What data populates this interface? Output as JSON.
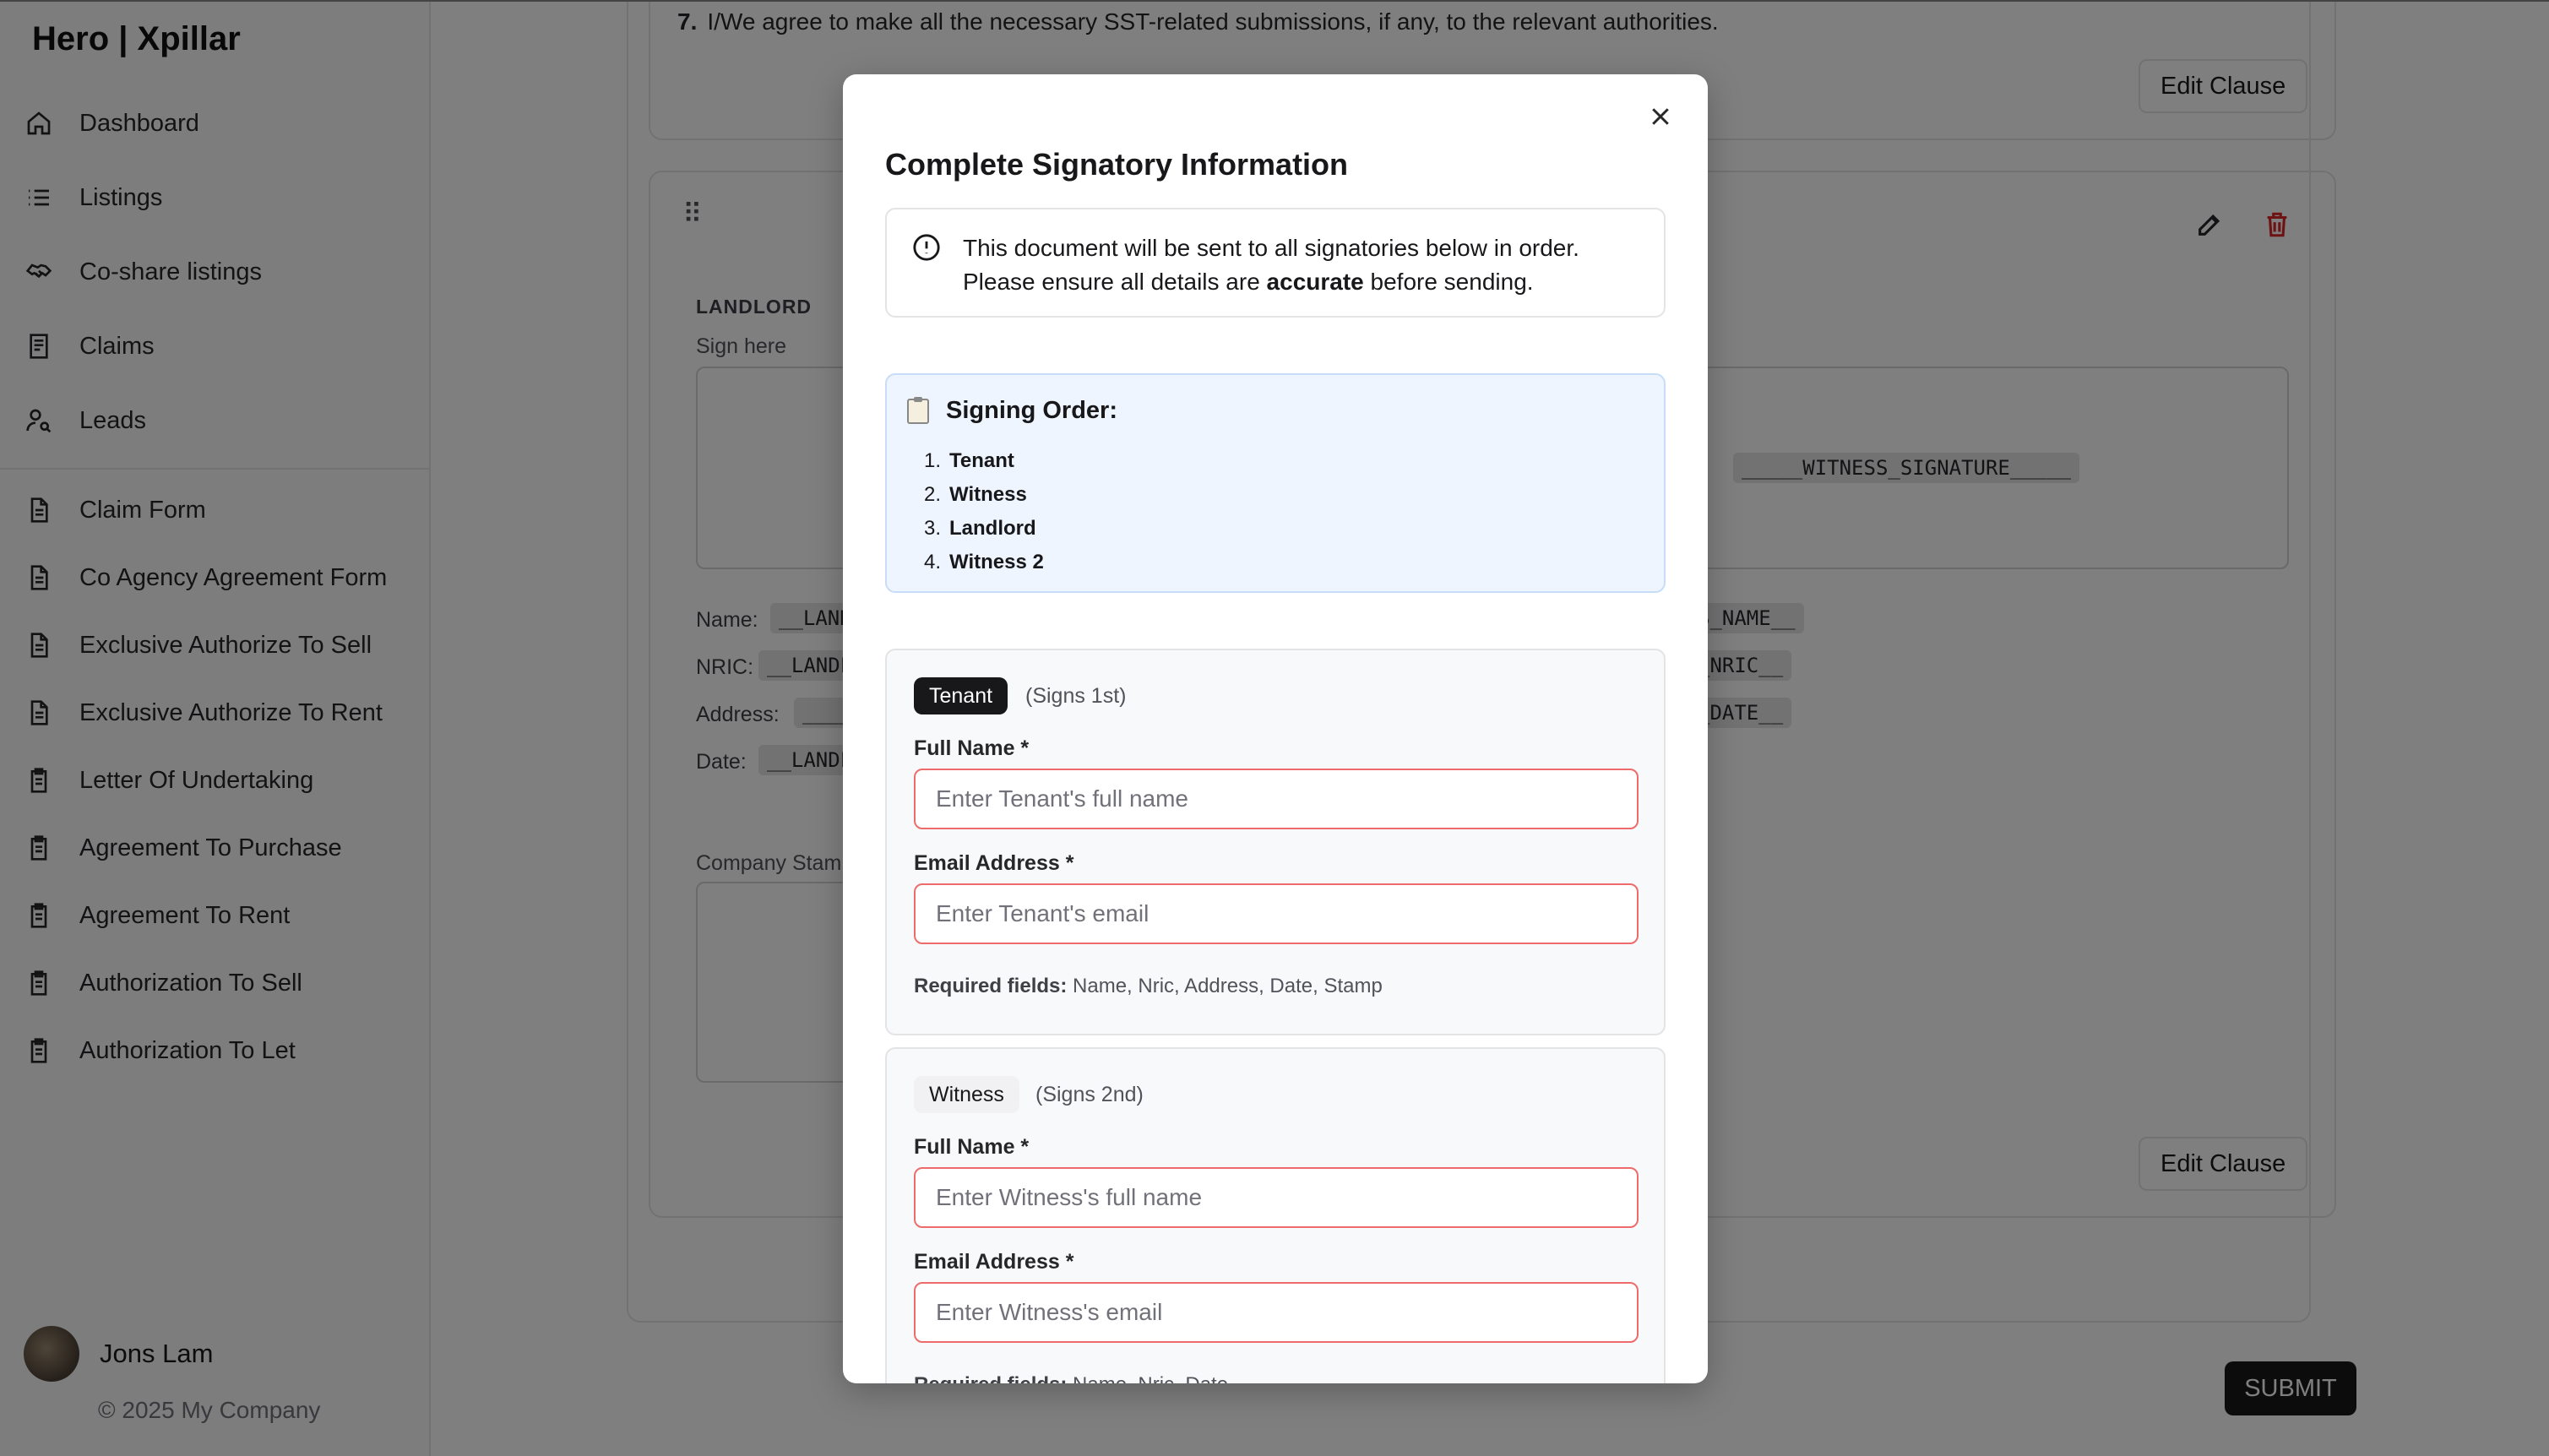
{
  "sidebar": {
    "brand": "Hero | Xpillar",
    "nav_main": [
      {
        "label": "Dashboard",
        "icon": "home-icon"
      },
      {
        "label": "Listings",
        "icon": "list-icon"
      },
      {
        "label": "Co-share listings",
        "icon": "handshake-icon"
      },
      {
        "label": "Claims",
        "icon": "receipt-icon"
      },
      {
        "label": "Leads",
        "icon": "user-search-icon"
      }
    ],
    "nav_forms": [
      {
        "label": "Claim Form",
        "icon": "file-text-icon"
      },
      {
        "label": "Co Agency Agreement Form",
        "icon": "file-text-icon"
      },
      {
        "label": "Exclusive Authorize To Sell",
        "icon": "file-text-icon"
      },
      {
        "label": "Exclusive Authorize To Rent",
        "icon": "file-text-icon"
      },
      {
        "label": "Letter Of Undertaking",
        "icon": "clipboard-icon"
      },
      {
        "label": "Agreement To Purchase",
        "icon": "clipboard-icon"
      },
      {
        "label": "Agreement To Rent",
        "icon": "clipboard-icon"
      },
      {
        "label": "Authorization To Sell",
        "icon": "clipboard-icon"
      },
      {
        "label": "Authorization To Let",
        "icon": "clipboard-icon"
      }
    ],
    "user_name": "Jons Lam",
    "copyright": "© 2025 My Company"
  },
  "document": {
    "clause7_number": "7.",
    "clause7_text": "I/We agree to make all the necessary SST-related submissions, if any, to the relevant authorities.",
    "edit_clause_label": "Edit Clause",
    "landlord_label": "LANDLORD",
    "sign_here": "Sign here",
    "witness_signature_placeholder": "_____WITNESS_SIGNATURE_____",
    "fields": {
      "name_label": "Name:",
      "name_left": "__LANDL",
      "name_right": "S_NAME__",
      "nric_label": "NRIC:",
      "nric_left": "__LANDL",
      "nric_right": "_NRIC__",
      "address_label": "Address:",
      "address_left": "____",
      "date_label": "Date:",
      "date_left": "__LANDL",
      "date_right": "_DATE__"
    },
    "company_stamp": "Company Stam",
    "submit_label": "SUBMIT"
  },
  "modal": {
    "title": "Complete Signatory Information",
    "notice_line1": "This document will be sent to all signatories below in order.",
    "notice_line2_prefix": "Please ensure all details are ",
    "notice_line2_bold": "accurate",
    "notice_line2_suffix": " before sending.",
    "signing_order_title": "Signing Order:",
    "signing_order": [
      {
        "n": "1.",
        "role": "Tenant"
      },
      {
        "n": "2.",
        "role": "Witness"
      },
      {
        "n": "3.",
        "role": "Landlord"
      },
      {
        "n": "4.",
        "role": "Witness 2"
      }
    ],
    "signatories": [
      {
        "role": "Tenant",
        "signs": "(Signs 1st)",
        "full_name_label": "Full Name *",
        "full_name_placeholder": "Enter Tenant's full name",
        "email_label": "Email Address *",
        "email_placeholder": "Enter Tenant's email",
        "required_label": "Required fields:",
        "required_fields": "Name, Nric, Address, Date, Stamp"
      },
      {
        "role": "Witness",
        "signs": "(Signs 2nd)",
        "full_name_label": "Full Name *",
        "full_name_placeholder": "Enter Witness's full name",
        "email_label": "Email Address *",
        "email_placeholder": "Enter Witness's email",
        "required_label": "Required fields:",
        "required_fields": "Name, Nric, Date"
      }
    ]
  },
  "colors": {
    "accent_dark": "#18181b",
    "error_border": "#ef6b6b",
    "delete_red": "#dc2626",
    "info_bg": "#eef5ff"
  }
}
